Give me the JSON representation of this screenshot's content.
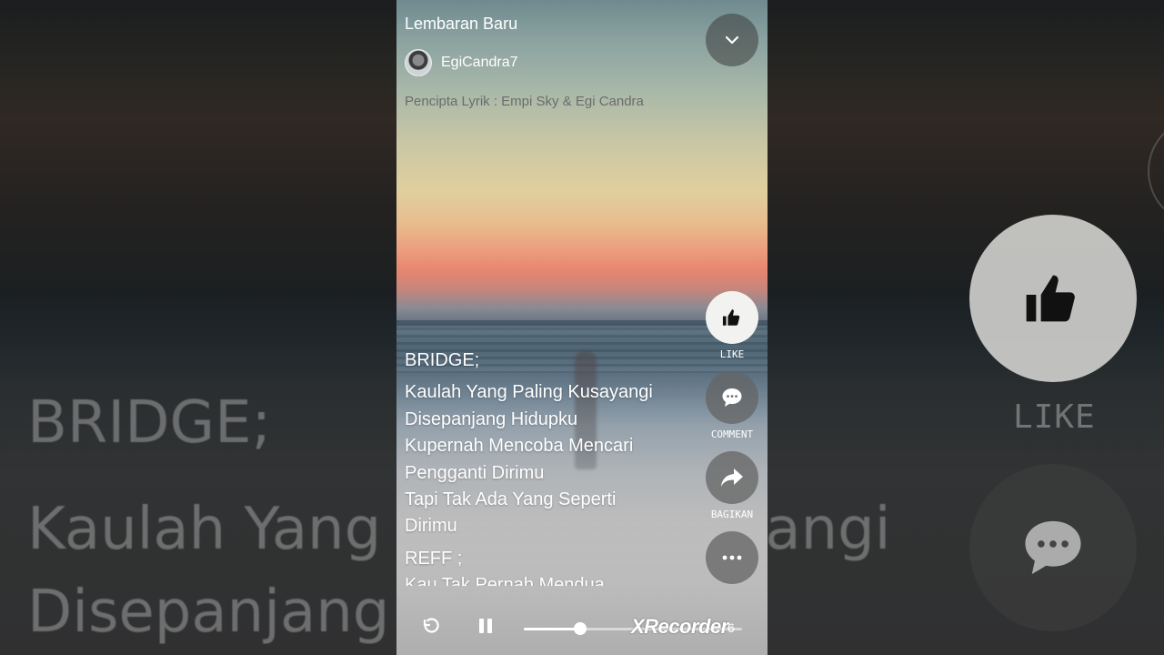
{
  "song": {
    "title": "Lembaran Baru",
    "username": "EgiCandra7",
    "credit": "Pencipta Lyrik : Empi Sky & Egi Candra"
  },
  "lyrics": [
    {
      "text": "BRIDGE;",
      "kind": "section"
    },
    {
      "text": "Kaulah Yang Paling Kusayangi",
      "kind": "line"
    },
    {
      "text": "Disepanjang Hidupku",
      "kind": "line"
    },
    {
      "text": "Kupernah Mencoba Mencari",
      "kind": "line"
    },
    {
      "text": "Pengganti Dirimu",
      "kind": "line"
    },
    {
      "text": "Tapi Tak Ada Yang Seperti",
      "kind": "line"
    },
    {
      "text": "Dirimu",
      "kind": "line"
    },
    {
      "text": "REFF ;",
      "kind": "section"
    },
    {
      "text": "Kau Tak Pernah Mendua",
      "kind": "line"
    }
  ],
  "actions": {
    "like": "LIKE",
    "comment": "COMMENT",
    "share": "BAGIKAN"
  },
  "player": {
    "progress": 0.26,
    "watermark": "XRecorder",
    "time_fragment": "6",
    "state": "playing"
  },
  "background": {
    "section": "BRIDGE;",
    "line1": "Kaulah Yang Paling Kusayangi",
    "line2": "Disepanjang Hidupku",
    "like": "LIKE",
    "comment": "COMMENT"
  },
  "icons": {
    "collapse": "chevron-down-icon",
    "like": "thumbs-up-icon",
    "comment": "comment-bubble-icon",
    "share": "share-arrow-icon",
    "more": "more-dots-icon",
    "replay": "replay-icon",
    "pause": "pause-icon"
  },
  "colors": {
    "accent": "#ffffff",
    "like_circle": "#f2f2f0",
    "action_circle": "#6b6b6b"
  }
}
